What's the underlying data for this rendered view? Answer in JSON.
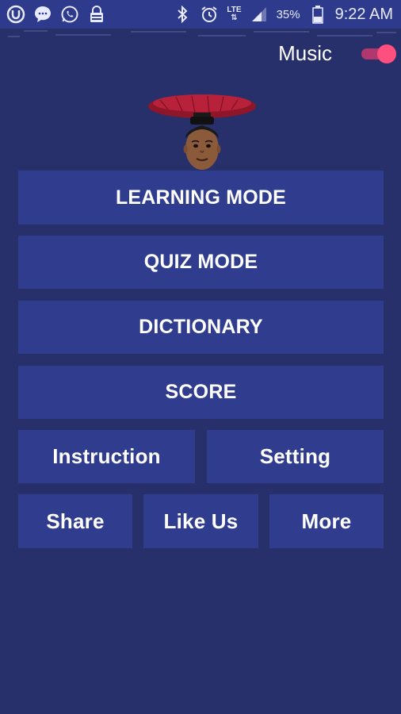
{
  "status_bar": {
    "signal_label": "LTE",
    "battery_percent": "35%",
    "time": "9:22 AM",
    "notification_icons": [
      "u-app-icon",
      "messenger-icon",
      "whatsapp-icon",
      "lock-app-icon"
    ],
    "system_icons": [
      "bluetooth-icon",
      "alarm-icon",
      "signal-icon",
      "battery-icon"
    ]
  },
  "settings": {
    "music_label": "Music",
    "music_on": true
  },
  "menu": {
    "learning_mode": "LEARNING MODE",
    "quiz_mode": "QUIZ MODE",
    "dictionary": "DICTIONARY",
    "score": "SCORE",
    "instruction": "Instruction",
    "setting": "Setting",
    "share": "Share",
    "like_us": "Like Us",
    "more": "More"
  },
  "colors": {
    "background": "#28306b",
    "button": "#303d8e",
    "status_bar": "#2e3a8c",
    "toggle_accent": "#ff4f7e"
  }
}
